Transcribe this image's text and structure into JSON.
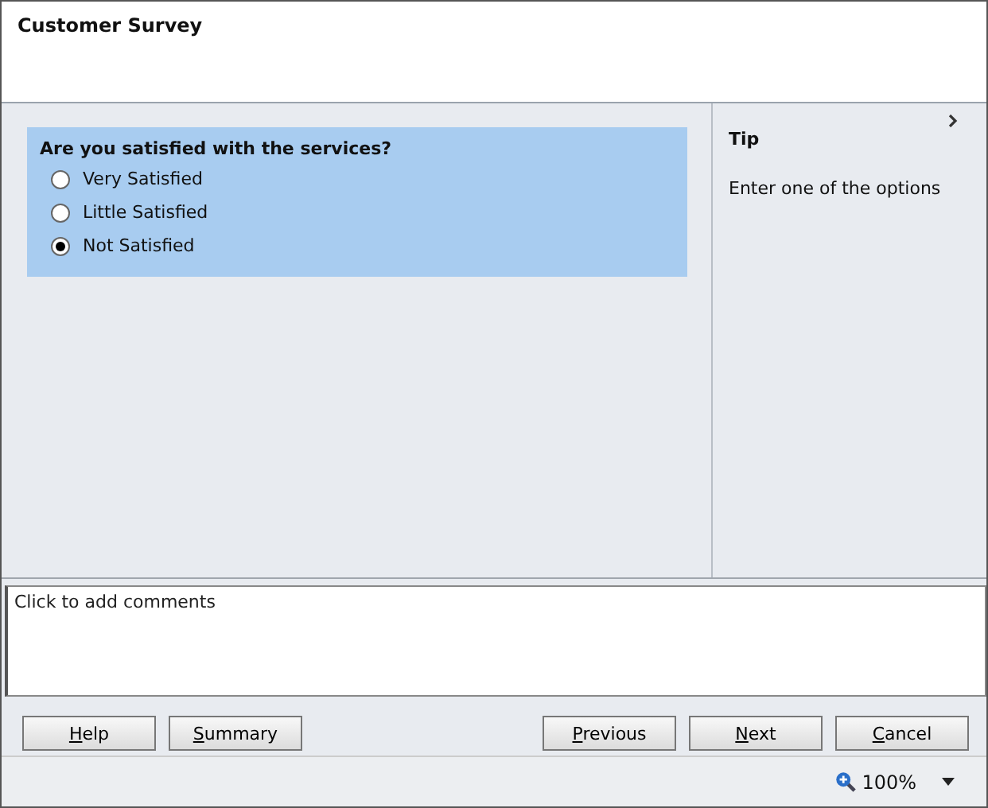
{
  "window": {
    "title": "Customer Survey"
  },
  "question": {
    "text": "Are you satisfied with the services?",
    "options": [
      {
        "label": "Very Satisfied",
        "selected": false
      },
      {
        "label": "Little Satisfied",
        "selected": false
      },
      {
        "label": "Not Satisfied",
        "selected": true
      }
    ]
  },
  "tip_pane": {
    "title": "Tip",
    "text": "Enter one of the options"
  },
  "comments": {
    "placeholder": "Click to add comments"
  },
  "buttons_left": [
    {
      "key": "H",
      "rest": "elp"
    },
    {
      "key": "S",
      "rest": "ummary"
    }
  ],
  "buttons_right": [
    {
      "key": "P",
      "rest": "revious"
    },
    {
      "key": "N",
      "rest": "ext"
    },
    {
      "key": "C",
      "rest": "ancel"
    }
  ],
  "status_bar": {
    "zoom": "100%"
  }
}
